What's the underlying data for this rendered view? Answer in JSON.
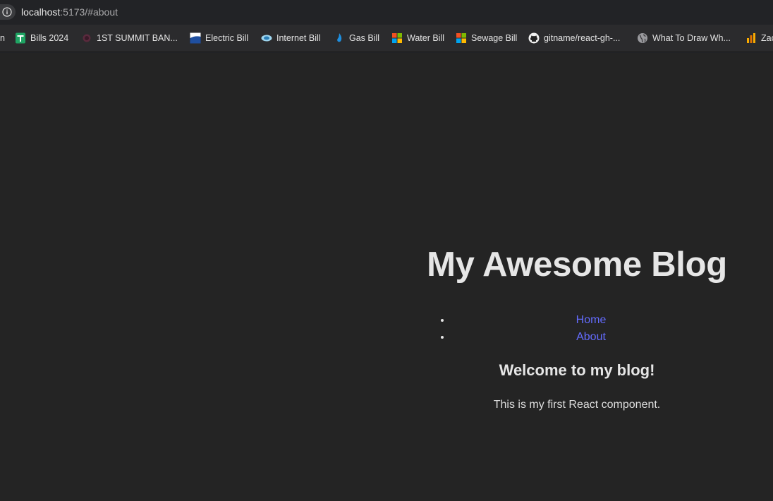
{
  "browser": {
    "url_host": "localhost",
    "url_path": ":5173/#about",
    "bookmarks": [
      {
        "label": "n",
        "icon": "truncated-icon"
      },
      {
        "label": "Bills 2024",
        "icon": "google-sheets-icon"
      },
      {
        "label": "1ST SUMMIT BAN...",
        "icon": "bank-icon"
      },
      {
        "label": "Electric Bill",
        "icon": "electric-company-icon"
      },
      {
        "label": "Internet Bill",
        "icon": "internet-provider-icon"
      },
      {
        "label": "Gas Bill",
        "icon": "gas-flame-icon"
      },
      {
        "label": "Water Bill",
        "icon": "windows-grid-icon"
      },
      {
        "label": "Sewage Bill",
        "icon": "windows-grid-icon"
      },
      {
        "label": "gitname/react-gh-...",
        "icon": "github-icon"
      },
      {
        "label": "What To Draw Wh...",
        "icon": "globe-icon"
      },
      {
        "label": "Zac",
        "icon": "analytics-icon"
      }
    ]
  },
  "page": {
    "title": "My Awesome Blog",
    "nav": [
      {
        "label": "Home"
      },
      {
        "label": "About"
      }
    ],
    "heading": "Welcome to my blog!",
    "body": "This is my first React component."
  },
  "colors": {
    "background": "#242424",
    "link": "#646cff",
    "text": "#e6e6e6"
  }
}
